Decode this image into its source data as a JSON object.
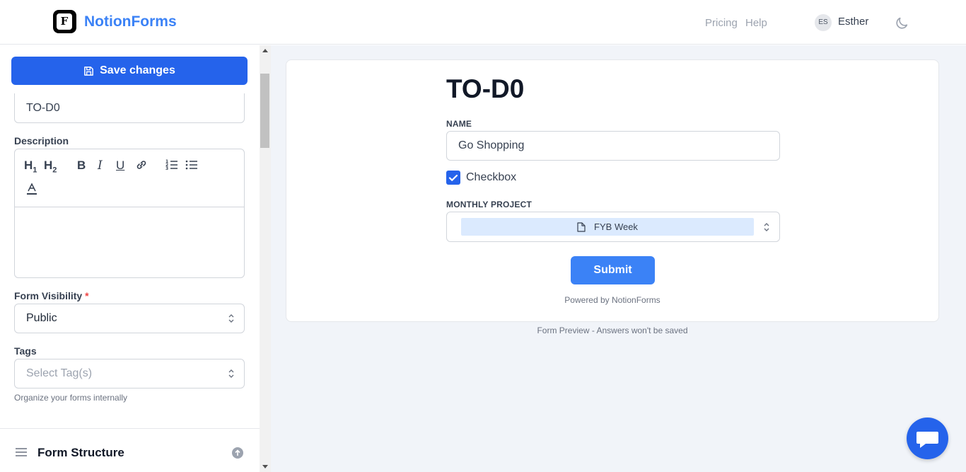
{
  "header": {
    "brand": "NotionForms",
    "logo_letter": "F",
    "nav": [
      "Pricing",
      "Help"
    ],
    "user": {
      "initials": "ES",
      "name": "Esther"
    },
    "theme_icon": "moon-icon"
  },
  "sidebar": {
    "save_label": "Save changes",
    "title_value": "TO-D0",
    "description_label": "Description",
    "editor_tools": [
      "H1",
      "H2",
      "B",
      "I",
      "U",
      "link",
      "ordered-list",
      "bullet-list",
      "text-color"
    ],
    "visibility_label": "Form Visibility",
    "visibility_required": "*",
    "visibility_value": "Public",
    "tags_label": "Tags",
    "tags_placeholder": "Select Tag(s)",
    "tags_hint": "Organize your forms internally",
    "structure_title": "Form Structure"
  },
  "preview": {
    "title": "TO-D0",
    "fields": {
      "name_label": "NAME",
      "name_value": "Go Shopping",
      "checkbox_label": "Checkbox",
      "checkbox_checked": true,
      "project_label": "MONTHLY PROJECT",
      "project_value": "FYB Week"
    },
    "submit_label": "Submit",
    "powered": "Powered by NotionForms",
    "note": "Form Preview - Answers won't be saved"
  },
  "colors": {
    "primary": "#2563eb",
    "brand": "#3b82f6",
    "chip": "#dbeafe",
    "preview_bg": "#f1f4f9"
  }
}
